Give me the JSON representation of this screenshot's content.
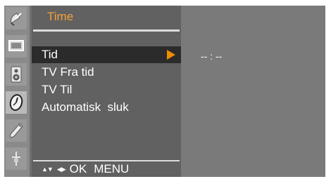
{
  "menu": {
    "title": "Time",
    "items": [
      {
        "label": "Tid",
        "selected": true
      },
      {
        "label": "TV Fra tid",
        "selected": false
      },
      {
        "label": "TV Til",
        "selected": false
      },
      {
        "label": "Automatisk  sluk",
        "selected": false
      }
    ]
  },
  "value_panel": {
    "time_value": "-- : --"
  },
  "nav_hint": {
    "updown_glyph": "▲▼",
    "leftright_glyph": "◀▶",
    "ok_label": "OK",
    "menu_label": "MENU"
  },
  "sidebar": {
    "icons": [
      {
        "name": "satellite-dish-icon",
        "selected": false
      },
      {
        "name": "screen-icon",
        "selected": false
      },
      {
        "name": "speaker-icon",
        "selected": false
      },
      {
        "name": "clock-icon",
        "selected": true
      },
      {
        "name": "wrench-icon",
        "selected": false
      },
      {
        "name": "plug-icon",
        "selected": false
      }
    ]
  },
  "colors": {
    "title_orange": "#f4a23a",
    "arrow_orange": "#f28c00",
    "selected_row": "#2b2b2b"
  }
}
